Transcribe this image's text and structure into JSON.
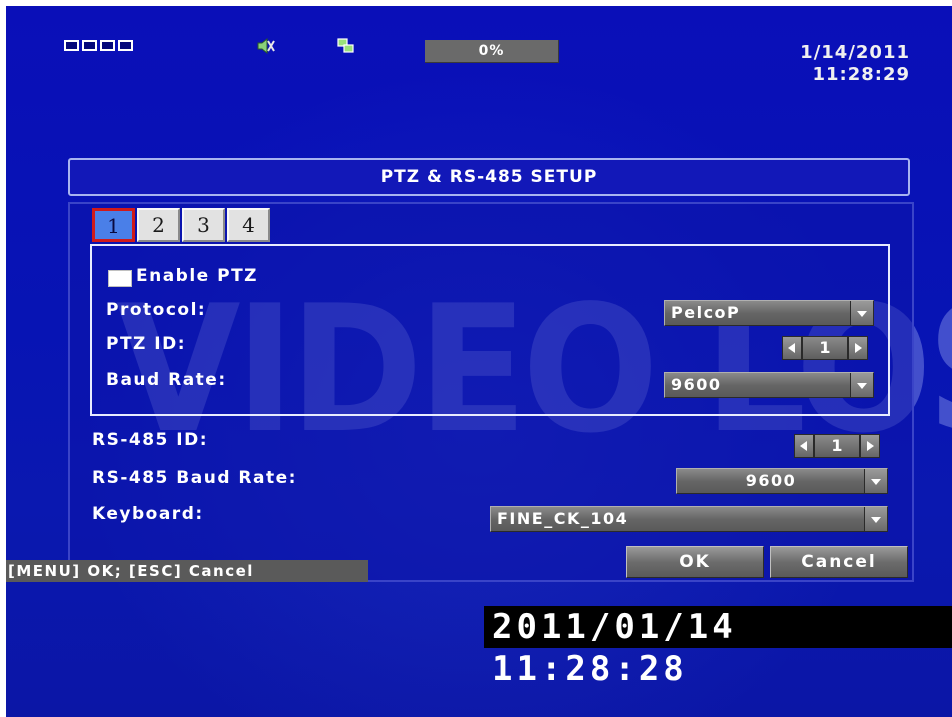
{
  "status_bar": {
    "record_percent": 0,
    "progress_text": "0%",
    "date": "1/14/2011",
    "time": "11:28:29"
  },
  "watermark": {
    "text": "VIDEO LOSS"
  },
  "dialog": {
    "title": "PTZ & RS-485 SETUP",
    "tabs": [
      {
        "label": "1",
        "selected": true
      },
      {
        "label": "2",
        "selected": false
      },
      {
        "label": "3",
        "selected": false
      },
      {
        "label": "4",
        "selected": false
      }
    ],
    "enable_ptz": {
      "label": "Enable PTZ",
      "checked": false
    },
    "protocol": {
      "label": "Protocol:",
      "value": "PelcoP"
    },
    "ptz_id": {
      "label": "PTZ ID:",
      "value": "1"
    },
    "baud_rate": {
      "label": "Baud Rate:",
      "value": "9600"
    },
    "rs485_id": {
      "label": "RS-485 ID:",
      "value": "1"
    },
    "rs485_baud_rate": {
      "label": "RS-485 Baud Rate:",
      "value": "9600"
    },
    "keyboard": {
      "label": "Keyboard:",
      "value": "FINE_CK_104"
    },
    "hint": "[MENU] OK; [ESC] Cancel",
    "ok_label": "OK",
    "cancel_label": "Cancel"
  },
  "timestamp_overlay": "2011/01/14 11:28:28",
  "colors": {
    "background": "#0a12b4",
    "selected_tab": "#4a7fe8",
    "selected_tab_border": "#d01a1a",
    "control_gray": "#6a6a6a"
  },
  "icons": [
    "camera-channels-icon",
    "speaker-mute-icon",
    "network-icon",
    "dropdown-arrow-icon",
    "stepper-left-icon",
    "stepper-right-icon"
  ]
}
